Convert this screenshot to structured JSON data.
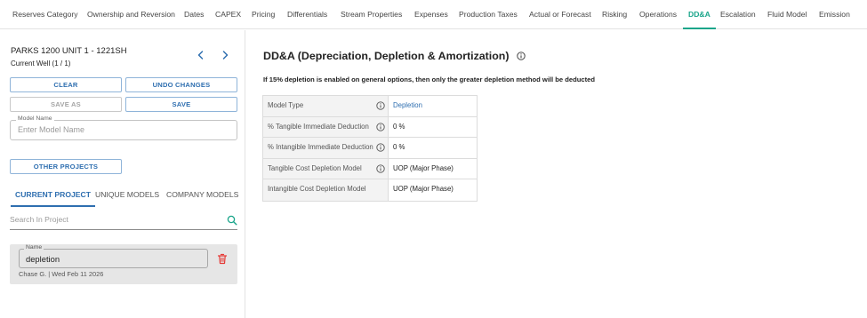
{
  "nav": {
    "tabs": [
      {
        "label": "Reserves Category"
      },
      {
        "label": "Ownership and Reversion"
      },
      {
        "label": "Dates"
      },
      {
        "label": "CAPEX"
      },
      {
        "label": "Pricing"
      },
      {
        "label": "Differentials"
      },
      {
        "label": "Stream Properties"
      },
      {
        "label": "Expenses"
      },
      {
        "label": "Production Taxes"
      },
      {
        "label": "Actual or Forecast"
      },
      {
        "label": "Risking"
      },
      {
        "label": "Operations"
      },
      {
        "label": "DD&A"
      },
      {
        "label": "Escalation"
      },
      {
        "label": "Fluid Model"
      },
      {
        "label": "Emission"
      }
    ],
    "active": "DD&A"
  },
  "well": {
    "name": "PARKS 1200 UNIT 1 - 1221SH",
    "subtitle": "Current Well (1 / 1)"
  },
  "actions": {
    "clear": "CLEAR",
    "undo": "UNDO CHANGES",
    "save_as": "SAVE AS",
    "save": "SAVE",
    "other_projects": "OTHER PROJECTS"
  },
  "model_name": {
    "label": "Model Name",
    "placeholder": "Enter Model Name"
  },
  "subtabs": [
    {
      "label": "CURRENT PROJECT"
    },
    {
      "label": "UNIQUE MODELS"
    },
    {
      "label": "COMPANY MODELS"
    }
  ],
  "search": {
    "placeholder": "Search In Project"
  },
  "saved_model": {
    "label": "Name",
    "value": "depletion",
    "meta": "Chase G. | Wed Feb 11 2026"
  },
  "content": {
    "title": "DD&A (Depreciation, Depletion & Amortization)",
    "notice": "If 15% depletion is enabled on general options, then only the greater depletion method will be deducted",
    "rows": [
      {
        "label": "Model Type",
        "value": "Depletion"
      },
      {
        "label": "% Tangible Immediate Deduction",
        "value": "0 %"
      },
      {
        "label": "% Intangible Immediate Deduction",
        "value": "0 %"
      },
      {
        "label": "Tangible Cost Depletion Model",
        "value": "UOP (Major Phase)"
      },
      {
        "label": "Intangible Cost Depletion Model",
        "value": "UOP (Major Phase)"
      }
    ]
  },
  "colors": {
    "accent_green": "#1aa58a",
    "accent_blue": "#2f6fb0",
    "delete_red": "#e53935"
  }
}
